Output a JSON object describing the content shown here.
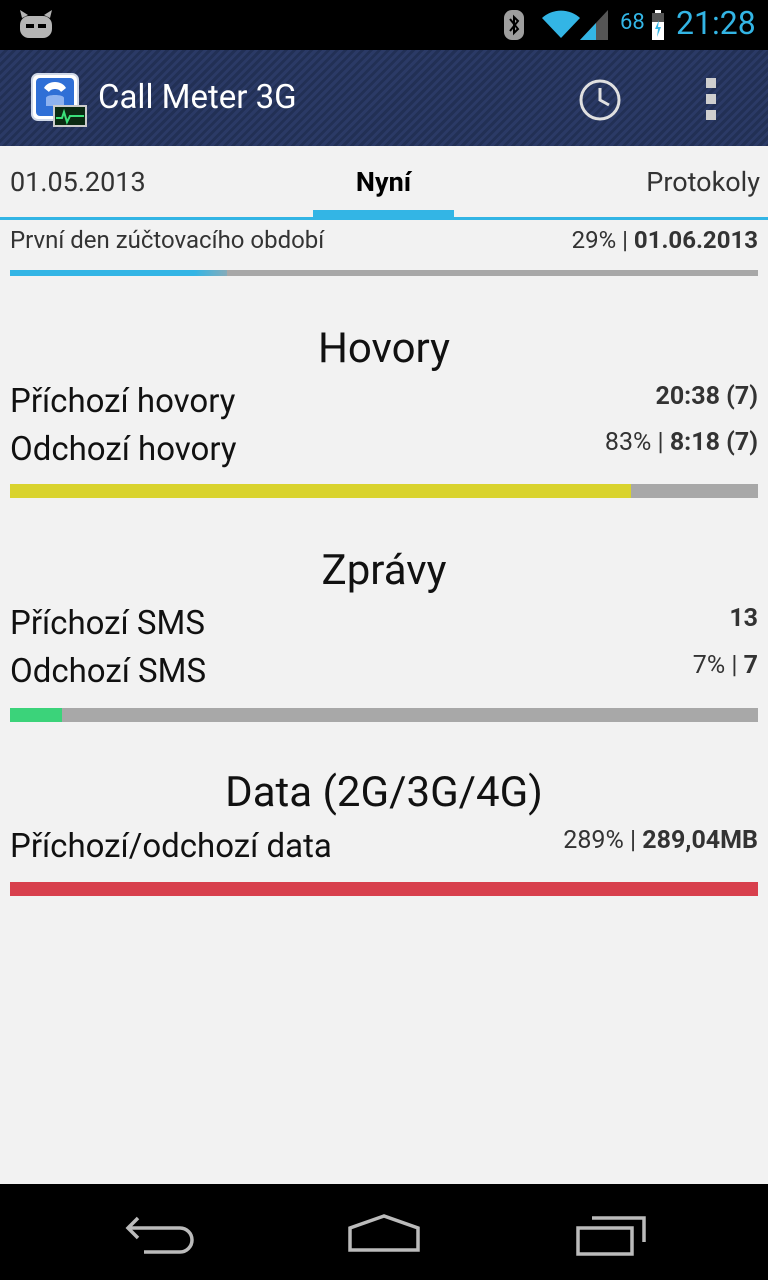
{
  "status_bar": {
    "battery_percent": "68",
    "time": "21:28"
  },
  "action_bar": {
    "title": "Call Meter 3G",
    "icons": [
      "app-icon",
      "history-icon",
      "overflow-menu-icon"
    ]
  },
  "tabs": {
    "left": "01.05.2013",
    "center": "Nyní",
    "right": "Protokoly"
  },
  "billing": {
    "label": "První den zúčtovacího období",
    "percent": "29%",
    "separator": " | ",
    "date": "01.06.2013",
    "progress": 0.29
  },
  "calls": {
    "title": "Hovory",
    "incoming_label": "Příchozí hovory",
    "incoming_value": "20:38 (7)",
    "outgoing_label": "Odchozí hovory",
    "outgoing_percent": "83%",
    "outgoing_value": "8:18 (7)",
    "progress": 0.83,
    "bar_color": "#d9d32e"
  },
  "messages": {
    "title": "Zprávy",
    "incoming_label": "Příchozí SMS",
    "incoming_value": "13",
    "outgoing_label": "Odchozí SMS",
    "outgoing_percent": "7%",
    "outgoing_value": "7",
    "progress": 0.07,
    "bar_color": "#3bd37a"
  },
  "data": {
    "title": "Data (2G/3G/4G)",
    "label": "Příchozí/odchozí data",
    "percent": "289%",
    "value": "289,04MB",
    "progress": 1.0,
    "bar_color": "#d8404d"
  },
  "colors": {
    "accent": "#33b5e5",
    "background": "#f2f2f2"
  }
}
